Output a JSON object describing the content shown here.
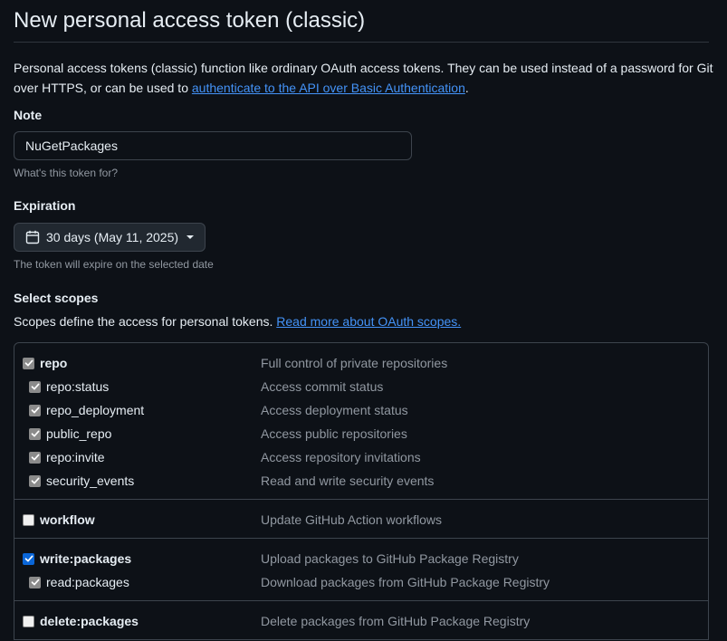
{
  "page": {
    "title": "New personal access token (classic)",
    "intro_text": "Personal access tokens (classic) function like ordinary OAuth access tokens. They can be used instead of a password for Git over HTTPS, or can be used to ",
    "intro_link": "authenticate to the API over Basic Authentication",
    "intro_end": "."
  },
  "note": {
    "label": "Note",
    "value": "NuGetPackages",
    "hint": "What's this token for?"
  },
  "expiration": {
    "label": "Expiration",
    "selected": "30 days (May 11, 2025)",
    "hint": "The token will expire on the selected date"
  },
  "scopes": {
    "label": "Select scopes",
    "description": "Scopes define the access for personal tokens. ",
    "link": "Read more about OAuth scopes.",
    "groups": [
      {
        "name": "repo",
        "desc": "Full control of private repositories",
        "checked": "indeterminate",
        "children": [
          {
            "name": "repo:status",
            "desc": "Access commit status",
            "checked": "implied"
          },
          {
            "name": "repo_deployment",
            "desc": "Access deployment status",
            "checked": "implied"
          },
          {
            "name": "public_repo",
            "desc": "Access public repositories",
            "checked": "implied"
          },
          {
            "name": "repo:invite",
            "desc": "Access repository invitations",
            "checked": "implied"
          },
          {
            "name": "security_events",
            "desc": "Read and write security events",
            "checked": "implied"
          }
        ]
      },
      {
        "name": "workflow",
        "desc": "Update GitHub Action workflows",
        "checked": "unchecked",
        "children": []
      },
      {
        "name": "write:packages",
        "desc": "Upload packages to GitHub Package Registry",
        "checked": "checked",
        "children": [
          {
            "name": "read:packages",
            "desc": "Download packages from GitHub Package Registry",
            "checked": "implied"
          }
        ]
      },
      {
        "name": "delete:packages",
        "desc": "Delete packages from GitHub Package Registry",
        "checked": "unchecked",
        "children": []
      }
    ]
  },
  "colors": {
    "background": "#0d1117",
    "border": "#3d444d",
    "link": "#4493f8",
    "muted": "#9198a1",
    "checkbox_checked": "#0a66d8",
    "checkbox_implied": "#8b8b8b"
  },
  "icons": {
    "expiration_dropdown": "calendar-icon",
    "dropdown_caret": "triangle-down-icon",
    "checkbox_mark": "check-icon"
  }
}
